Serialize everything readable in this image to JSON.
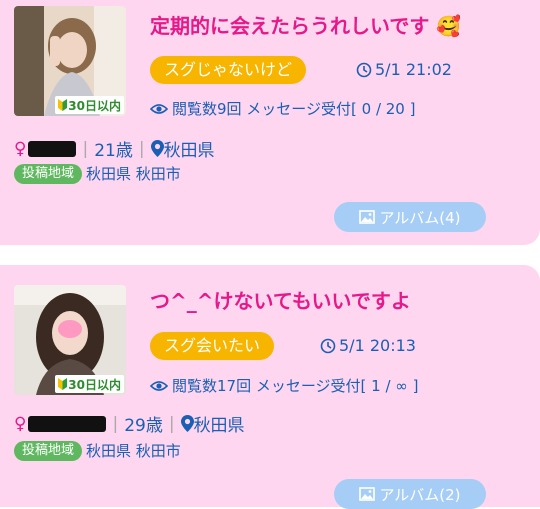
{
  "posts": [
    {
      "badge": "30日以内",
      "title": "定期的に会えたらうれしいです",
      "title_emoji": "🥰",
      "tag": "スグじゃないけど",
      "time": "5/1 21:02",
      "stats": "閲覧数9回 メッセージ受付[ 0 / 20 ]",
      "gender": "♀",
      "age": "21歳",
      "location": "秋田県",
      "region_label": "投稿地域",
      "region": "秋田県 秋田市",
      "album": "アルバム(4)"
    },
    {
      "badge": "30日以内",
      "title": "つ^_^けないてもいいですよ",
      "title_emoji": "",
      "tag": "スグ会いたい",
      "time": "5/1 20:13",
      "stats": "閲覧数17回 メッセージ受付[ 1 / ∞ ]",
      "gender": "♀",
      "age": "29歳",
      "location": "秋田県",
      "region_label": "投稿地域",
      "region": "秋田県 秋田市",
      "album": "アルバム(2)"
    }
  ],
  "colors": {
    "card_bg": "#ffd6f0",
    "title": "#e6198a",
    "tag": "#f7b500",
    "text": "#1a5fb4",
    "region_tag": "#5fb85f",
    "album": "#a6cdf5"
  },
  "icons": [
    "clock-icon",
    "eye-icon",
    "location-pin-icon",
    "image-icon",
    "beginner-leaf-icon"
  ]
}
